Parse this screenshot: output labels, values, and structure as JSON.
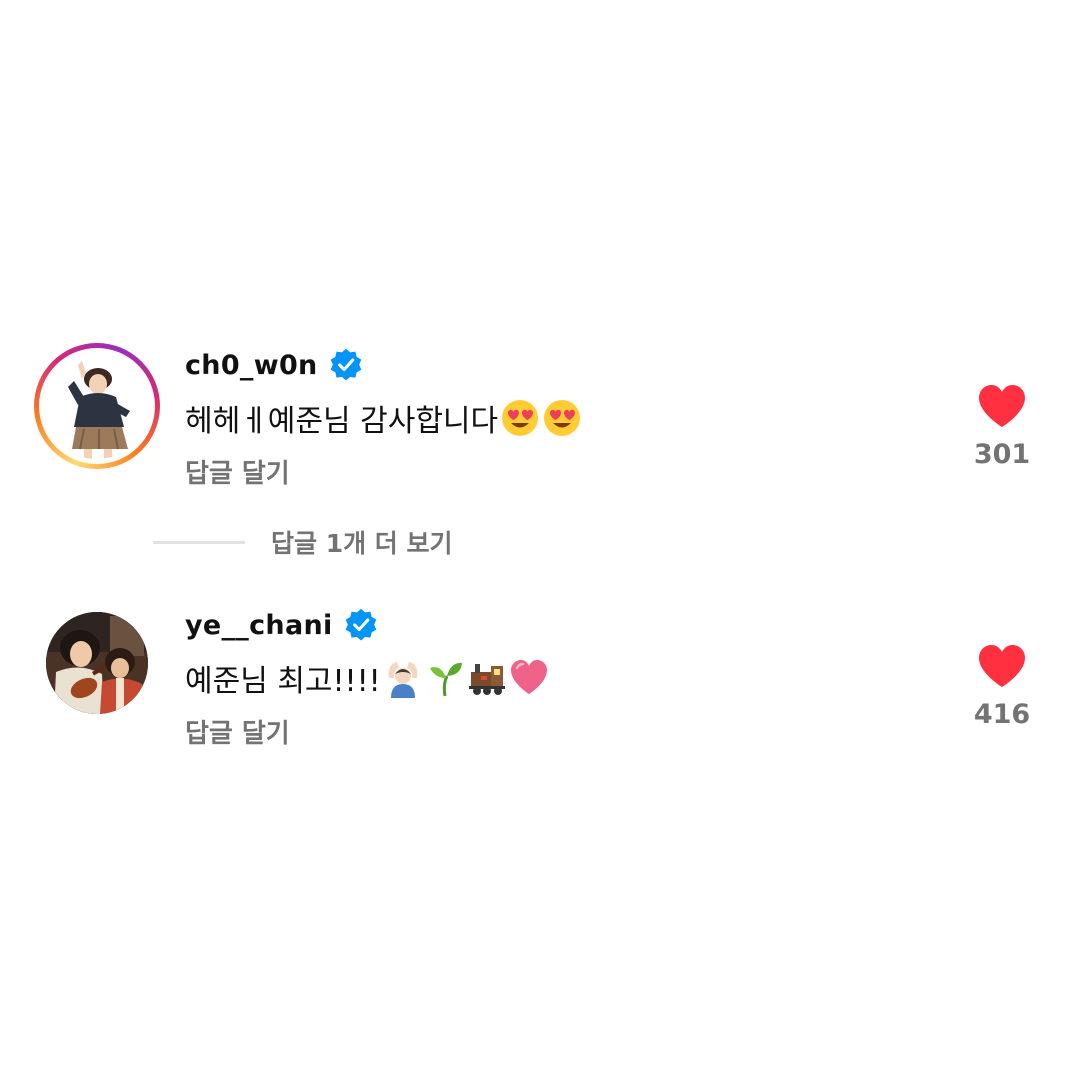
{
  "comments": [
    {
      "username": "ch0_w0n",
      "verified": true,
      "avatar_icon": "cartoon-boy-avatar-icon",
      "avatar_has_story_ring": true,
      "text": "헤헤ㅔ예준님 감사합니다",
      "emojis": [
        "heart-eyes-emoji",
        "heart-eyes-emoji"
      ],
      "reply_label": "답글 달기",
      "like_count": "301"
    },
    {
      "username": "ye__chani",
      "verified": true,
      "avatar_icon": "anime-scene-avatar-icon",
      "avatar_has_story_ring": false,
      "text": "예준님 최고!!!!",
      "emojis": [
        "person-gesturing-ok-emoji",
        "seedling-emoji",
        "locomotive-emoji",
        "pink-heart-emoji"
      ],
      "reply_label": "답글 달기",
      "like_count": "416"
    }
  ],
  "more_replies_label": "답글 1개 더 보기",
  "colors": {
    "heart": "#ff3040",
    "verified": "#0095f6",
    "secondary_text": "#737373",
    "primary_text": "#111111"
  }
}
